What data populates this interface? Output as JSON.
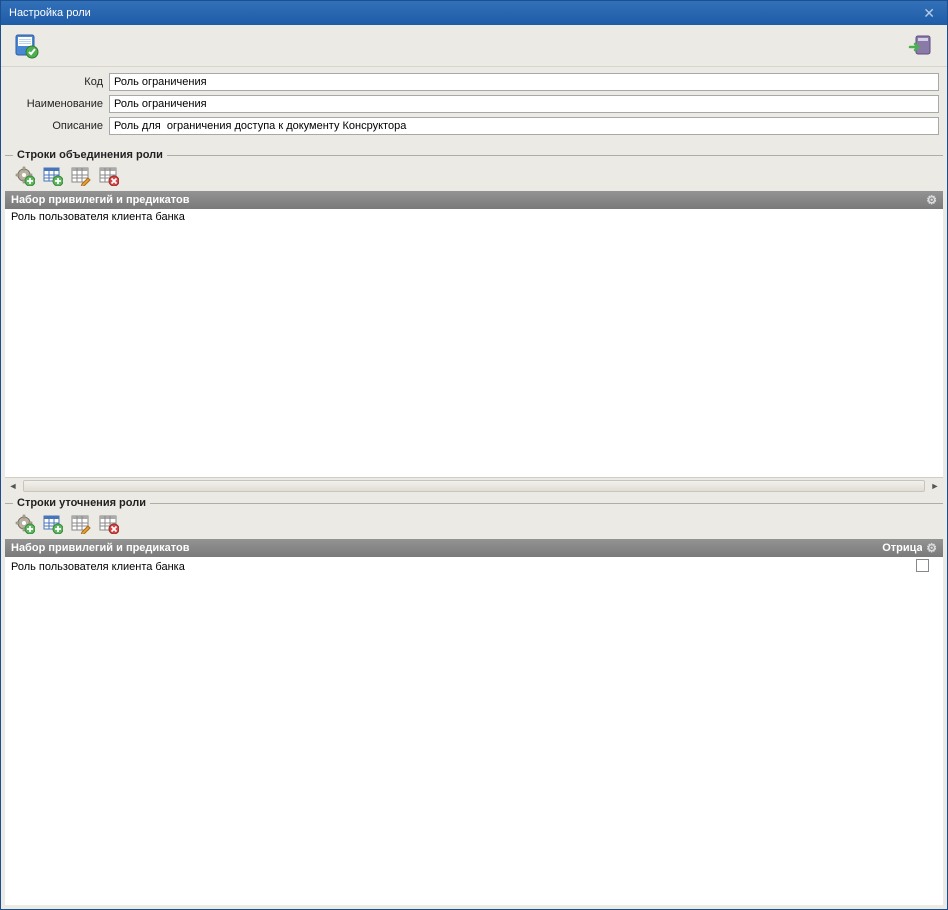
{
  "window": {
    "title": "Настройка роли"
  },
  "form": {
    "code_label": "Код",
    "code_value": "Роль ограничения",
    "name_label": "Наименование",
    "name_value": "Роль ограничения",
    "desc_label": "Описание",
    "desc_value": "Роль для  ограничения доступа к документу Консруктора"
  },
  "section1": {
    "title": "Строки объединения роли",
    "grid_header": "Набор привилегий и предикатов",
    "rows": [
      {
        "text": "Роль пользователя клиента банка"
      }
    ]
  },
  "section2": {
    "title": "Строки уточнения роли",
    "grid_header": "Набор привилегий и предикатов",
    "col2_header": "Отрица",
    "rows": [
      {
        "text": "Роль пользователя клиента банка",
        "negate": false
      }
    ]
  },
  "icons": {
    "save": "save-ok-icon",
    "publish": "publish-icon",
    "gear_add": "gear-add-icon",
    "table_add": "table-add-icon",
    "table_edit": "table-edit-icon",
    "table_delete": "table-delete-icon"
  }
}
